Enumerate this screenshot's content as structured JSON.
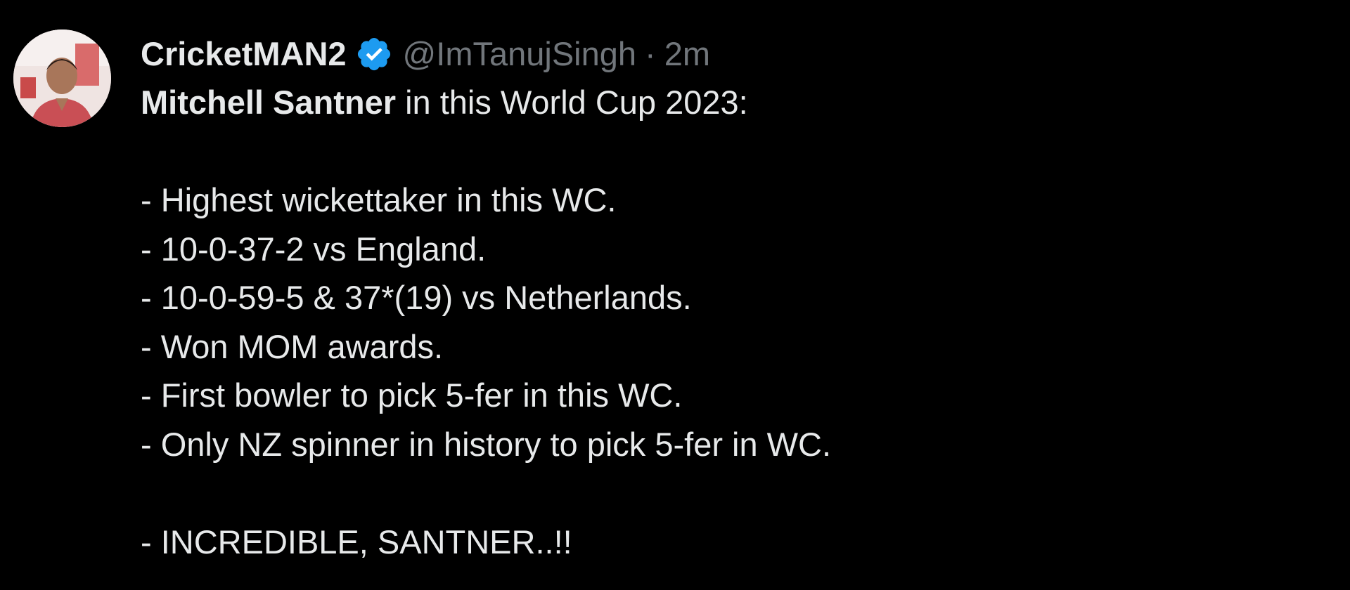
{
  "user": {
    "display_name": "CricketMAN2",
    "handle": "@ImTanujSingh",
    "separator": "·",
    "time": "2m",
    "verified_icon": "verified-badge-icon",
    "avatar_icon": "user-avatar"
  },
  "tweet": {
    "first_line_bold": "Mitchell Santner",
    "first_line_rest": " in this World Cup 2023:",
    "bullets": [
      "- Highest wickettaker in this WC.",
      "- 10-0-37-2 vs England.",
      "- 10-0-59-5 & 37*(19) vs Netherlands.",
      "- Won MOM awards.",
      "- First bowler to pick 5-fer in this WC.",
      "- Only NZ spinner in history to pick 5-fer in WC."
    ],
    "closing": "- INCREDIBLE, SANTNER..!!"
  },
  "colors": {
    "background": "#000000",
    "text": "#e7e9ea",
    "muted": "#71767b",
    "verified": "#1d9bf0"
  }
}
